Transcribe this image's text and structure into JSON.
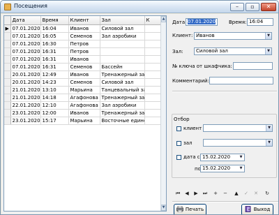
{
  "window": {
    "title": "Посещения"
  },
  "grid": {
    "columns": [
      "Дата",
      "Время",
      "Клиент",
      "Зал",
      "К"
    ],
    "rows": [
      [
        "07.01.2020",
        "16:04",
        "Иванов",
        "Силовой зал"
      ],
      [
        "07.01.2020",
        "16:05",
        "Семенов",
        "Зал аэробики"
      ],
      [
        "07.01.2020",
        "16:30",
        "Петров",
        ""
      ],
      [
        "07.01.2020",
        "16:31",
        "Петров",
        ""
      ],
      [
        "07.01.2020",
        "16:31",
        "Иванов",
        ""
      ],
      [
        "07.01.2020",
        "16:31",
        "Семенов",
        "Бассейн"
      ],
      [
        "20.01.2020",
        "12:49",
        "Иванов",
        "Тренажерный зал"
      ],
      [
        "20.01.2020",
        "14:23",
        "Семенов",
        "Силовой зал"
      ],
      [
        "21.01.2020",
        "13:10",
        "Марьина",
        "Танцевальный зал"
      ],
      [
        "21.01.2020",
        "14:18",
        "Агафонова",
        "Тренажерный зал"
      ],
      [
        "22.01.2020",
        "12:10",
        "Агафонова",
        "Зал аэробики"
      ],
      [
        "23.01.2020",
        "12:00",
        "Иванов",
        "Тренажерный зал"
      ],
      [
        "23.01.2020",
        "15:17",
        "Марьина",
        "Восточные едино"
      ]
    ],
    "selected_row": 0,
    "indicator": "▶"
  },
  "form": {
    "date_label": "Дата:",
    "date_value": "07.01.2020",
    "time_label": "Время:",
    "time_value": "16:04",
    "client_label": "Клиент:",
    "client_value": "Иванов",
    "hall_label": "Зал:",
    "hall_value": "Силовой зал",
    "key_label": "№ ключа от шкафчика:",
    "key_value": "",
    "comment_label": "Комментарий:",
    "comment_value": ""
  },
  "filter": {
    "title": "Отбор",
    "client_label": "клиент",
    "hall_label": "зал",
    "date_from_label": "дата с",
    "date_from_value": "15.02.2020",
    "date_to_label": "по",
    "date_to_value": "15.02.2020"
  },
  "navigator": {
    "buttons": [
      {
        "name": "first",
        "glyph": "⏮",
        "enabled": true
      },
      {
        "name": "prior",
        "glyph": "◀",
        "enabled": true
      },
      {
        "name": "next",
        "glyph": "▶",
        "enabled": true
      },
      {
        "name": "last",
        "glyph": "⏭",
        "enabled": true
      },
      {
        "name": "insert",
        "glyph": "+",
        "enabled": true
      },
      {
        "name": "delete",
        "glyph": "−",
        "enabled": true
      },
      {
        "name": "edit",
        "glyph": "▲",
        "enabled": true
      },
      {
        "name": "post",
        "glyph": "✓",
        "enabled": false
      },
      {
        "name": "cancel",
        "glyph": "✕",
        "enabled": false
      },
      {
        "name": "refresh",
        "glyph": "↻",
        "enabled": true
      }
    ]
  },
  "buttons": {
    "print": "Печать",
    "exit": "Выход"
  }
}
